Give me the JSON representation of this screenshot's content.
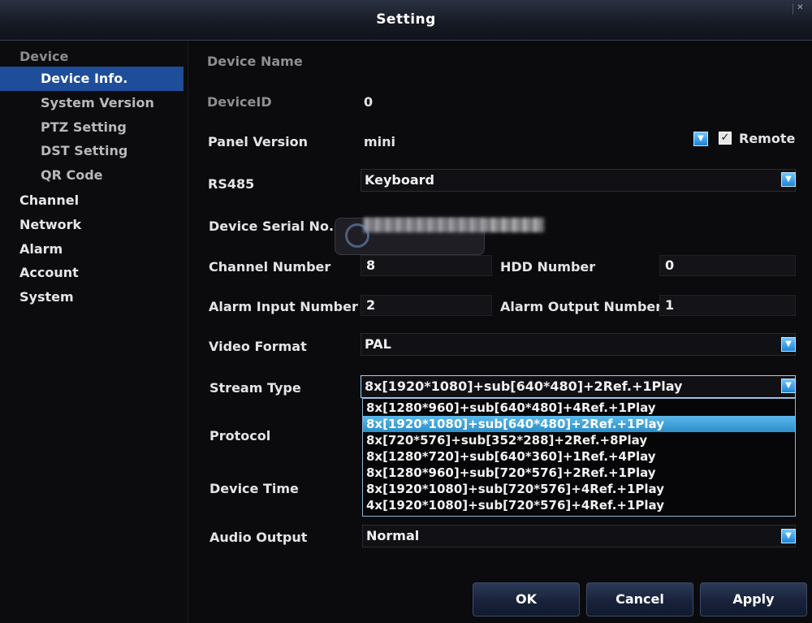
{
  "window": {
    "title": "Setting"
  },
  "sidebar": {
    "group_device": "Device",
    "device_items": [
      {
        "label": "Device Info.",
        "active": true
      },
      {
        "label": "System Version"
      },
      {
        "label": "PTZ Setting"
      },
      {
        "label": "DST Setting"
      },
      {
        "label": "QR Code"
      }
    ],
    "groups": [
      "Channel",
      "Network",
      "Alarm",
      "Account",
      "System"
    ]
  },
  "form": {
    "device_name": {
      "label": "Device Name",
      "value": ""
    },
    "device_id": {
      "label": "DeviceID",
      "value": "0"
    },
    "panel_version": {
      "label": "Panel Version",
      "value": "mini",
      "remote_label": "Remote",
      "remote_checked": true
    },
    "rs485": {
      "label": "RS485",
      "value": "Keyboard"
    },
    "serial": {
      "label": "Device Serial No."
    },
    "channel_number": {
      "label": "Channel Number",
      "value": "8"
    },
    "hdd_number": {
      "label": "HDD Number",
      "value": "0"
    },
    "alarm_input": {
      "label": "Alarm Input Number",
      "value": "2"
    },
    "alarm_output": {
      "label": "Alarm Output Number",
      "value": "1"
    },
    "video_format": {
      "label": "Video Format",
      "value": "PAL"
    },
    "stream_type": {
      "label": "Stream Type",
      "value": "8x[1920*1080]+sub[640*480]+2Ref.+1Play",
      "options": [
        "8x[1280*960]+sub[640*480]+4Ref.+1Play",
        "8x[1920*1080]+sub[640*480]+2Ref.+1Play",
        "8x[720*576]+sub[352*288]+2Ref.+8Play",
        "8x[1280*720]+sub[640*360]+1Ref.+4Play",
        "8x[1280*960]+sub[720*576]+2Ref.+1Play",
        "8x[1920*1080]+sub[720*576]+4Ref.+1Play",
        "4x[1920*1080]+sub[720*576]+4Ref.+1Play"
      ],
      "selected_index": 1
    },
    "protocol": {
      "label": "Protocol"
    },
    "device_time": {
      "label": "Device Time"
    },
    "audio_output": {
      "label": "Audio Output",
      "value": "Normal"
    }
  },
  "buttons": {
    "ok": "OK",
    "cancel": "Cancel",
    "apply": "Apply"
  },
  "colors": {
    "accent": "#1e4d9a",
    "dropdown_highlight": "#3ea4dd",
    "background": "#0b0b0d"
  }
}
